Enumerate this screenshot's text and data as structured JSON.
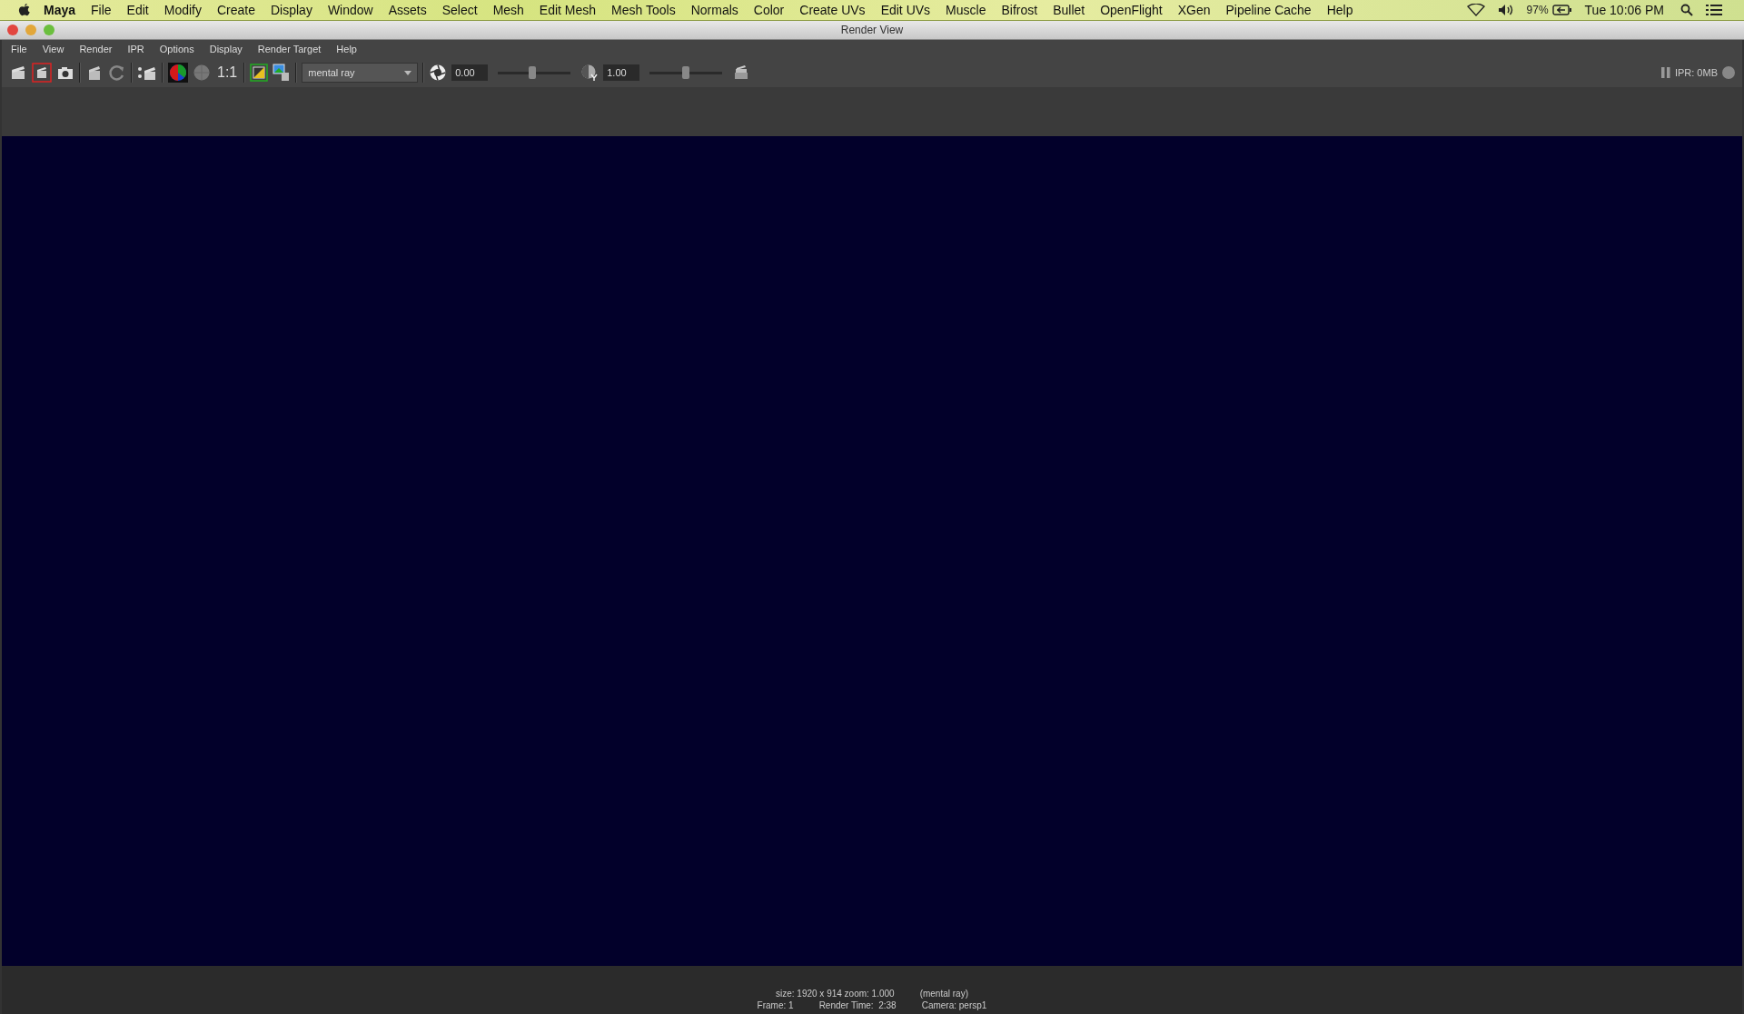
{
  "mac_menu_bar": {
    "app_name": "Maya",
    "items": [
      "File",
      "Edit",
      "Modify",
      "Create",
      "Display",
      "Window",
      "Assets",
      "Select",
      "Mesh",
      "Edit Mesh",
      "Mesh Tools",
      "Normals",
      "Color",
      "Create UVs",
      "Edit UVs",
      "Muscle",
      "Bifrost",
      "Bullet",
      "OpenFlight",
      "XGen",
      "Pipeline Cache",
      "Help"
    ],
    "battery": "97%",
    "clock": "Tue 10:06 PM"
  },
  "window": {
    "title": "Render View"
  },
  "menu": [
    "File",
    "View",
    "Render",
    "IPR",
    "Options",
    "Display",
    "Render Target",
    "Help"
  ],
  "toolbar": {
    "ratio_button": "1:1",
    "renderer": "mental ray",
    "exposure": {
      "value": "0.00",
      "level": 0.47
    },
    "gamma": {
      "value": "1.00",
      "level": 0.5
    },
    "ipr_memory": "IPR: 0MB"
  },
  "status": {
    "line_1": [
      "size: 1920 x 914 zoom: 1.000",
      "(mental ray)"
    ],
    "line_2": [
      "Frame: 1",
      "Render Time:  2:38",
      "Camera: persp1"
    ]
  }
}
